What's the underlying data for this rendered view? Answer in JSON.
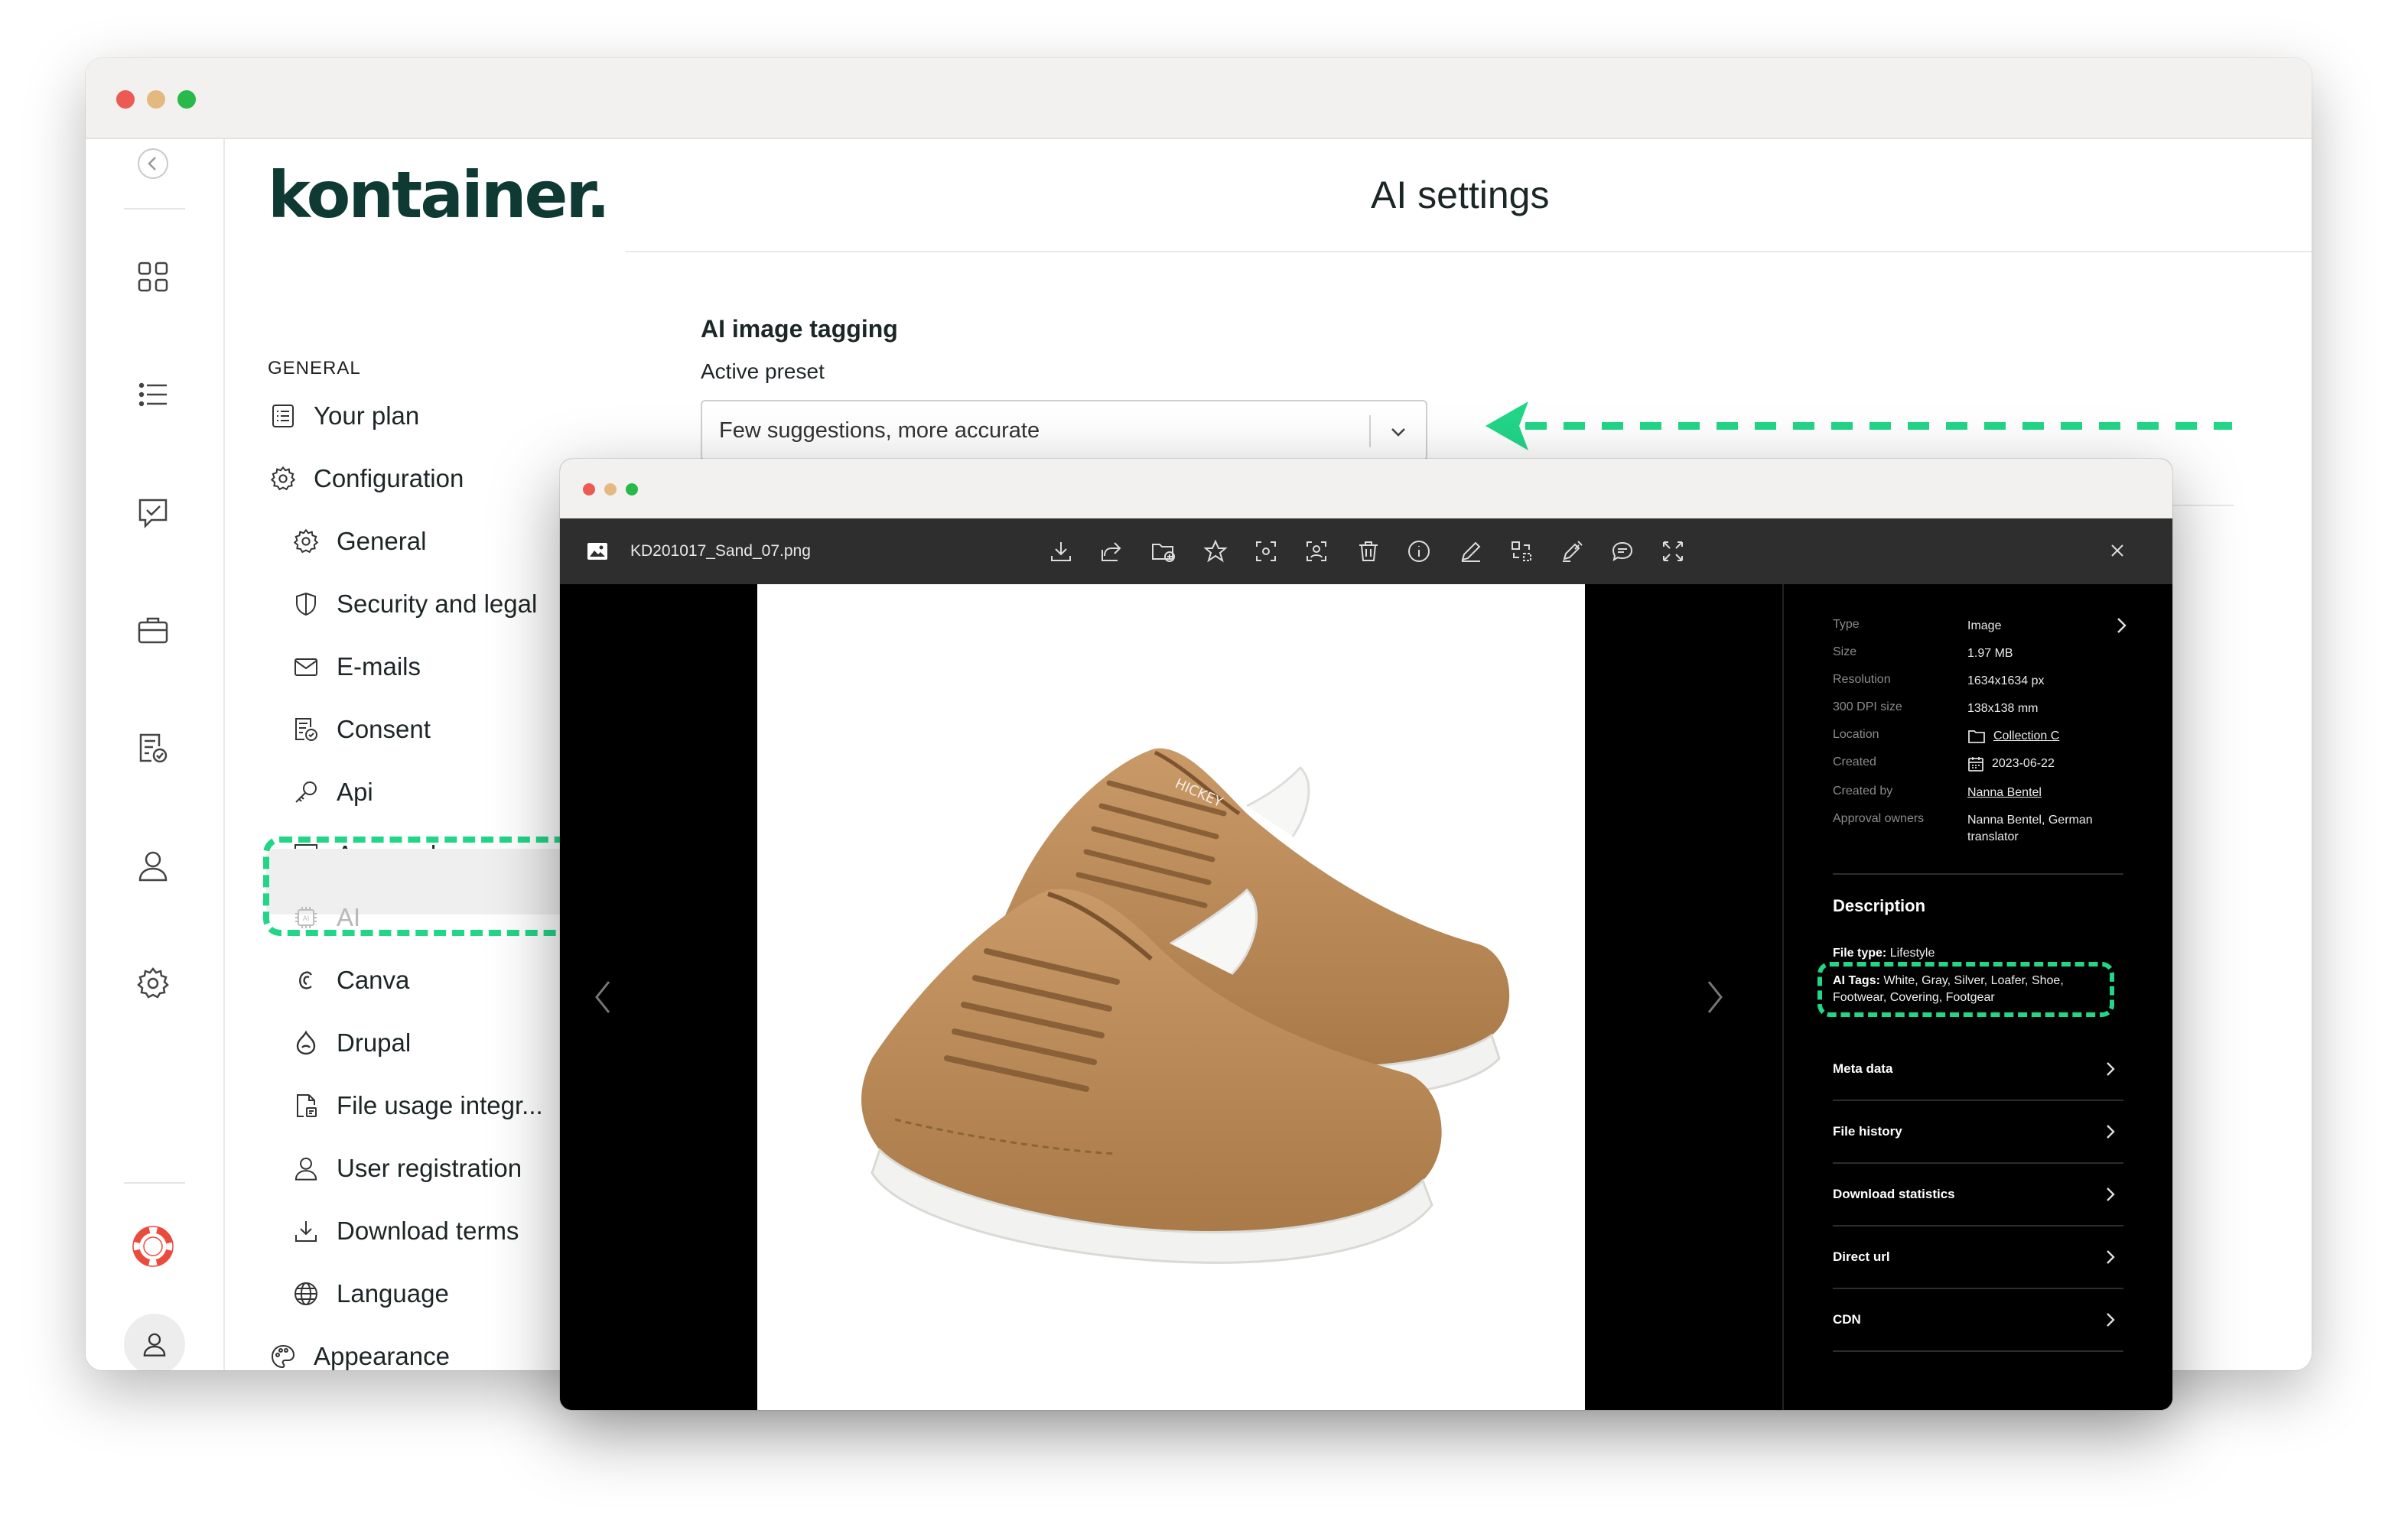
{
  "back_window": {
    "brand": "kontainer.",
    "page_title": "AI settings",
    "nav": {
      "heading": "GENERAL",
      "your_plan": "Your plan",
      "configuration": "Configuration",
      "general": "General",
      "security": "Security and legal",
      "emails": "E-mails",
      "consent": "Consent",
      "api": "Api",
      "approval": "Approval",
      "ai": "AI",
      "canva": "Canva",
      "drupal": "Drupal",
      "file_usage": "File usage integr...",
      "user_registration": "User registration",
      "download_terms": "Download terms",
      "language": "Language",
      "appearance": "Appearance"
    },
    "ai_tagging": {
      "title": "AI image tagging",
      "preset_label": "Active preset",
      "preset_value": "Few suggestions, more accurate"
    }
  },
  "viewer": {
    "filename": "KD201017_Sand_07.png",
    "meta": {
      "type_label": "Type",
      "type_value": "Image",
      "size_label": "Size",
      "size_value": "1.97 MB",
      "resolution_label": "Resolution",
      "resolution_value": "1634x1634 px",
      "dpi_label": "300 DPI size",
      "dpi_value": "138x138 mm",
      "location_label": "Location",
      "location_value": "Collection C",
      "created_label": "Created",
      "created_value": "2023-06-22",
      "created_by_label": "Created by",
      "created_by_value": "Nanna Bentel",
      "approval_label": "Approval owners",
      "approval_value": "Nanna Bentel, German translator"
    },
    "description": {
      "title": "Description",
      "file_type_label": "File type:",
      "file_type_value": "Lifestyle",
      "ai_tags_label": "AI Tags:",
      "ai_tags_value": "White, Gray, Silver, Loafer, Shoe, Footwear, Covering, Footgear"
    },
    "sections": {
      "meta_data": "Meta data",
      "file_history": "File history",
      "download_statistics": "Download statistics",
      "direct_url": "Direct url",
      "cdn": "CDN"
    },
    "shoe_brand_mark": "HICKEY"
  },
  "colors": {
    "accent_green": "#22d688",
    "brand_dark": "#0e3a33",
    "toolbar": "#2e2e2e",
    "shoe_suede": "#bf8f5c"
  }
}
